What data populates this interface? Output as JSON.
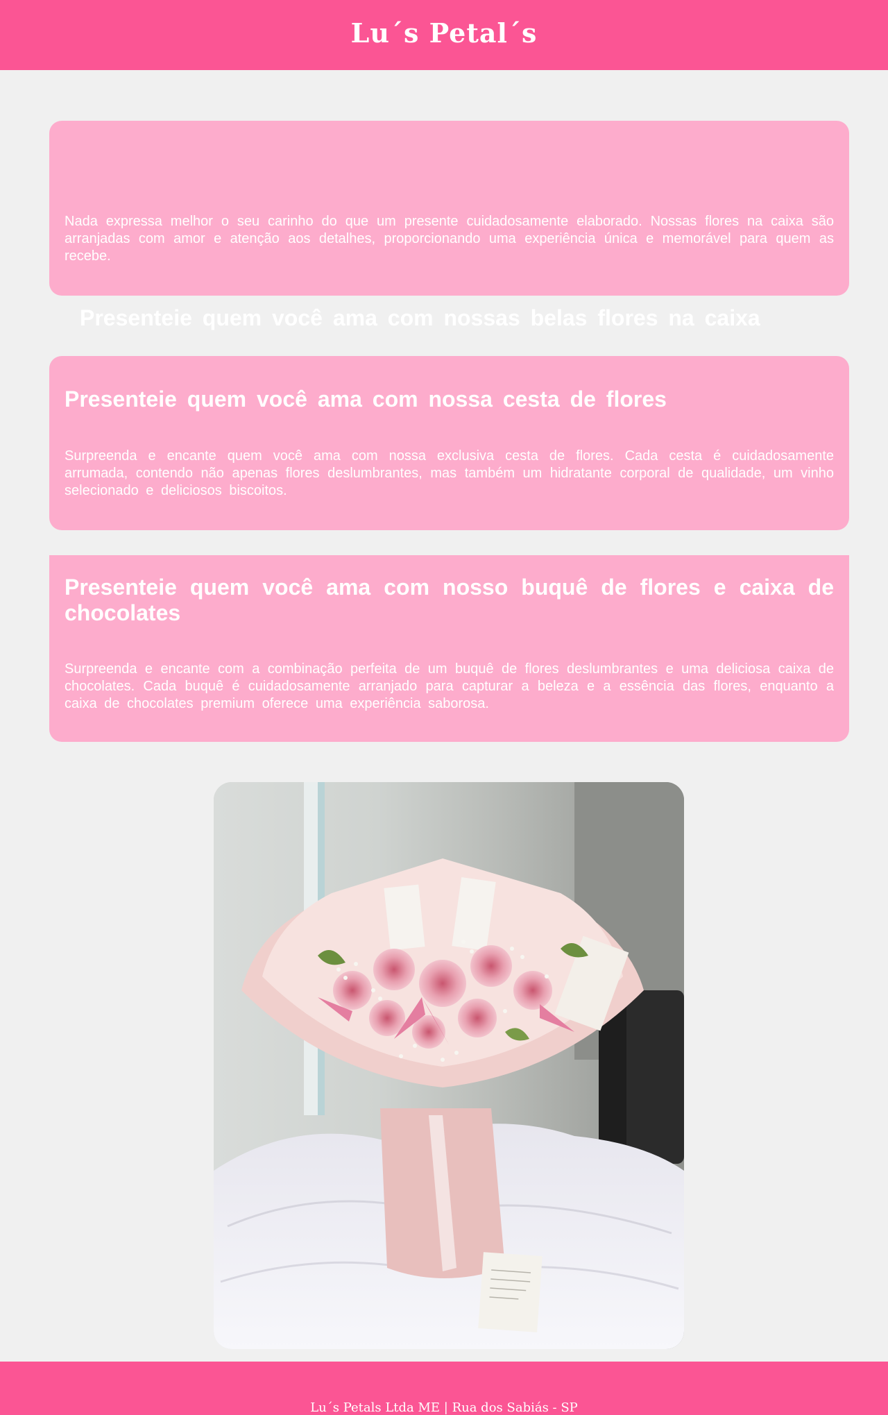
{
  "header": {
    "title": "Lu´s Petal´s"
  },
  "sections": [
    {
      "title": "Presenteie quem você ama com nossas belas flores na caixa",
      "body": "Nada expressa melhor o seu carinho do que um presente cuidadosamente elaborado. Nossas flores na caixa são arranjadas com amor e atenção aos detalhes, proporcionando uma experiência única e memorável para quem as recebe."
    },
    {
      "title": "Presenteie quem você ama com nossa cesta de flores",
      "body": "Surpreenda e encante quem você ama com nossa exclusiva cesta de flores. Cada cesta é cuidadosamente arrumada, contendo não apenas flores deslumbrantes, mas também um hidratante corporal de qualidade, um vinho selecionado e deliciosos biscoitos."
    },
    {
      "title": "Presenteie quem você ama com nosso buquê de flores e caixa de chocolates",
      "body": "Surpreenda e encante com a combinação perfeita de um buquê de flores deslumbrantes e uma deliciosa caixa de chocolates. Cada buquê é cuidadosamente arranjado para capturar a beleza e a essência das flores, enquanto a caixa de chocolates premium oferece uma experiência saborosa."
    }
  ],
  "footer": {
    "text": "Lu´s Petals Ltda ME | Rua dos Sabiás - SP"
  },
  "colors": {
    "brand_pink": "#fb5594",
    "card_pink": "#fdaccc",
    "page_background": "#f0f0f0",
    "text_white": "#ffffff"
  },
  "icons": [
    "bouquet-photo"
  ]
}
